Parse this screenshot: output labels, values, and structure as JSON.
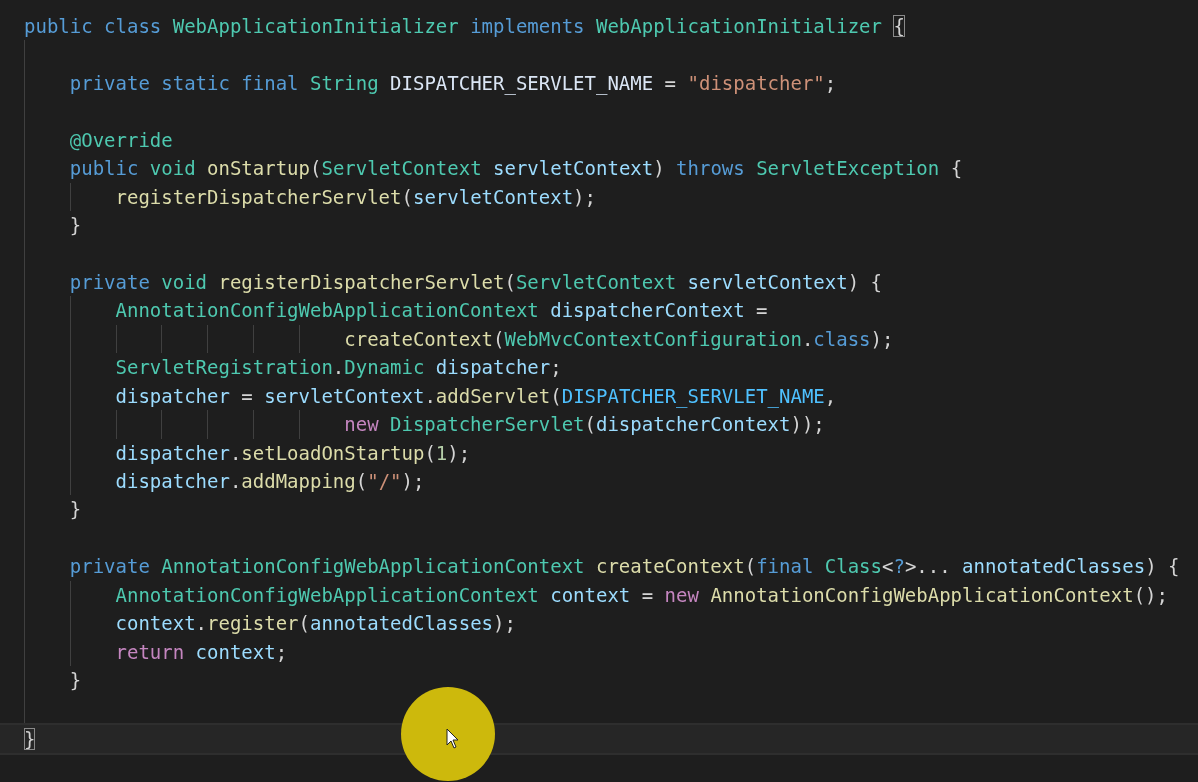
{
  "editor": {
    "lines": [
      {
        "kind": "code",
        "tokens": [
          {
            "kind": "kw",
            "text": "public class "
          },
          {
            "kind": "type",
            "text": "WebApplicationInitializer "
          },
          {
            "kind": "kw",
            "text": "implements "
          },
          {
            "kind": "type",
            "text": "WebApplicationInitializer "
          },
          {
            "kind": "punc",
            "text": "{",
            "matched": true
          }
        ]
      },
      {
        "kind": "blank"
      },
      {
        "kind": "code",
        "tokens": [
          {
            "kind": "kw",
            "text": "    private static final "
          },
          {
            "kind": "type",
            "text": "String "
          },
          {
            "kind": "field",
            "text": "DISPATCHER_SERVLET_NAME "
          },
          {
            "kind": "punc",
            "text": "= "
          },
          {
            "kind": "str",
            "text": "\"dispatcher\""
          },
          {
            "kind": "punc",
            "text": ";"
          }
        ]
      },
      {
        "kind": "blank"
      },
      {
        "kind": "code",
        "tokens": [
          {
            "kind": "anno",
            "text": "    @Override"
          }
        ]
      },
      {
        "kind": "code",
        "tokens": [
          {
            "kind": "kw",
            "text": "    public "
          },
          {
            "kind": "type",
            "text": "void "
          },
          {
            "kind": "fn",
            "text": "onStartup"
          },
          {
            "kind": "punc",
            "text": "("
          },
          {
            "kind": "type",
            "text": "ServletContext "
          },
          {
            "kind": "var",
            "text": "servletContext"
          },
          {
            "kind": "punc",
            "text": ") "
          },
          {
            "kind": "kw",
            "text": "throws "
          },
          {
            "kind": "type",
            "text": "ServletException "
          },
          {
            "kind": "punc",
            "text": "{"
          }
        ]
      },
      {
        "kind": "code",
        "tokens": [
          {
            "kind": "fn",
            "text": "        registerDispatcherServlet"
          },
          {
            "kind": "punc",
            "text": "("
          },
          {
            "kind": "var",
            "text": "servletContext"
          },
          {
            "kind": "punc",
            "text": ");"
          }
        ]
      },
      {
        "kind": "code",
        "tokens": [
          {
            "kind": "punc",
            "text": "    }"
          }
        ]
      },
      {
        "kind": "blank"
      },
      {
        "kind": "code",
        "tokens": [
          {
            "kind": "kw",
            "text": "    private "
          },
          {
            "kind": "type",
            "text": "void "
          },
          {
            "kind": "fn",
            "text": "registerDispatcherServlet"
          },
          {
            "kind": "punc",
            "text": "("
          },
          {
            "kind": "type",
            "text": "ServletContext "
          },
          {
            "kind": "var",
            "text": "servletContext"
          },
          {
            "kind": "punc",
            "text": ") {"
          }
        ]
      },
      {
        "kind": "code",
        "tokens": [
          {
            "kind": "type",
            "text": "        AnnotationConfigWebApplicationContext "
          },
          {
            "kind": "var",
            "text": "dispatcherContext "
          },
          {
            "kind": "punc",
            "text": "="
          }
        ]
      },
      {
        "kind": "code",
        "tokens": [
          {
            "kind": "fn",
            "text": "                            createContext"
          },
          {
            "kind": "punc",
            "text": "("
          },
          {
            "kind": "type",
            "text": "WebMvcContextConfiguration"
          },
          {
            "kind": "punc",
            "text": "."
          },
          {
            "kind": "kw",
            "text": "class"
          },
          {
            "kind": "punc",
            "text": ");"
          }
        ]
      },
      {
        "kind": "code",
        "tokens": [
          {
            "kind": "type",
            "text": "        ServletRegistration"
          },
          {
            "kind": "punc",
            "text": "."
          },
          {
            "kind": "type",
            "text": "Dynamic "
          },
          {
            "kind": "var",
            "text": "dispatcher"
          },
          {
            "kind": "punc",
            "text": ";"
          }
        ]
      },
      {
        "kind": "code",
        "tokens": [
          {
            "kind": "var",
            "text": "        dispatcher "
          },
          {
            "kind": "punc",
            "text": "= "
          },
          {
            "kind": "var",
            "text": "servletContext"
          },
          {
            "kind": "punc",
            "text": "."
          },
          {
            "kind": "fn",
            "text": "addServlet"
          },
          {
            "kind": "punc",
            "text": "("
          },
          {
            "kind": "const",
            "text": "DISPATCHER_SERVLET_NAME"
          },
          {
            "kind": "punc",
            "text": ","
          }
        ]
      },
      {
        "kind": "code",
        "tokens": [
          {
            "kind": "ctrl",
            "text": "                            new "
          },
          {
            "kind": "type",
            "text": "DispatcherServlet"
          },
          {
            "kind": "punc",
            "text": "("
          },
          {
            "kind": "var",
            "text": "dispatcherContext"
          },
          {
            "kind": "punc",
            "text": "));"
          }
        ]
      },
      {
        "kind": "code",
        "tokens": [
          {
            "kind": "var",
            "text": "        dispatcher"
          },
          {
            "kind": "punc",
            "text": "."
          },
          {
            "kind": "fn",
            "text": "setLoadOnStartup"
          },
          {
            "kind": "punc",
            "text": "("
          },
          {
            "kind": "num",
            "text": "1"
          },
          {
            "kind": "punc",
            "text": ");"
          }
        ]
      },
      {
        "kind": "code",
        "tokens": [
          {
            "kind": "var",
            "text": "        dispatcher"
          },
          {
            "kind": "punc",
            "text": "."
          },
          {
            "kind": "fn",
            "text": "addMapping"
          },
          {
            "kind": "punc",
            "text": "("
          },
          {
            "kind": "str",
            "text": "\"/\""
          },
          {
            "kind": "punc",
            "text": ");"
          }
        ]
      },
      {
        "kind": "code",
        "tokens": [
          {
            "kind": "punc",
            "text": "    }"
          }
        ]
      },
      {
        "kind": "blank"
      },
      {
        "kind": "code",
        "tokens": [
          {
            "kind": "kw",
            "text": "    private "
          },
          {
            "kind": "type",
            "text": "AnnotationConfigWebApplicationContext "
          },
          {
            "kind": "fn",
            "text": "createContext"
          },
          {
            "kind": "punc",
            "text": "("
          },
          {
            "kind": "kw",
            "text": "final "
          },
          {
            "kind": "type",
            "text": "Class"
          },
          {
            "kind": "punc",
            "text": "<"
          },
          {
            "kind": "kw",
            "text": "?"
          },
          {
            "kind": "punc",
            "text": ">... "
          },
          {
            "kind": "var",
            "text": "annotatedClasses"
          },
          {
            "kind": "punc",
            "text": ") {"
          }
        ]
      },
      {
        "kind": "code",
        "tokens": [
          {
            "kind": "type",
            "text": "        AnnotationConfigWebApplicationContext "
          },
          {
            "kind": "var",
            "text": "context "
          },
          {
            "kind": "punc",
            "text": "= "
          },
          {
            "kind": "ctrl",
            "text": "new "
          },
          {
            "kind": "fn",
            "text": "AnnotationConfigWebApplicationContext"
          },
          {
            "kind": "punc",
            "text": "();"
          }
        ]
      },
      {
        "kind": "code",
        "tokens": [
          {
            "kind": "var",
            "text": "        context"
          },
          {
            "kind": "punc",
            "text": "."
          },
          {
            "kind": "fn",
            "text": "register"
          },
          {
            "kind": "punc",
            "text": "("
          },
          {
            "kind": "var",
            "text": "annotatedClasses"
          },
          {
            "kind": "punc",
            "text": ");"
          }
        ]
      },
      {
        "kind": "code",
        "tokens": [
          {
            "kind": "ctrl",
            "text": "        return "
          },
          {
            "kind": "var",
            "text": "context"
          },
          {
            "kind": "punc",
            "text": ";"
          }
        ]
      },
      {
        "kind": "code",
        "tokens": [
          {
            "kind": "punc",
            "text": "    }"
          }
        ]
      },
      {
        "kind": "blank"
      },
      {
        "kind": "code",
        "current": true,
        "tokens": [
          {
            "kind": "punc",
            "text": "}",
            "matched": true
          }
        ]
      }
    ]
  }
}
